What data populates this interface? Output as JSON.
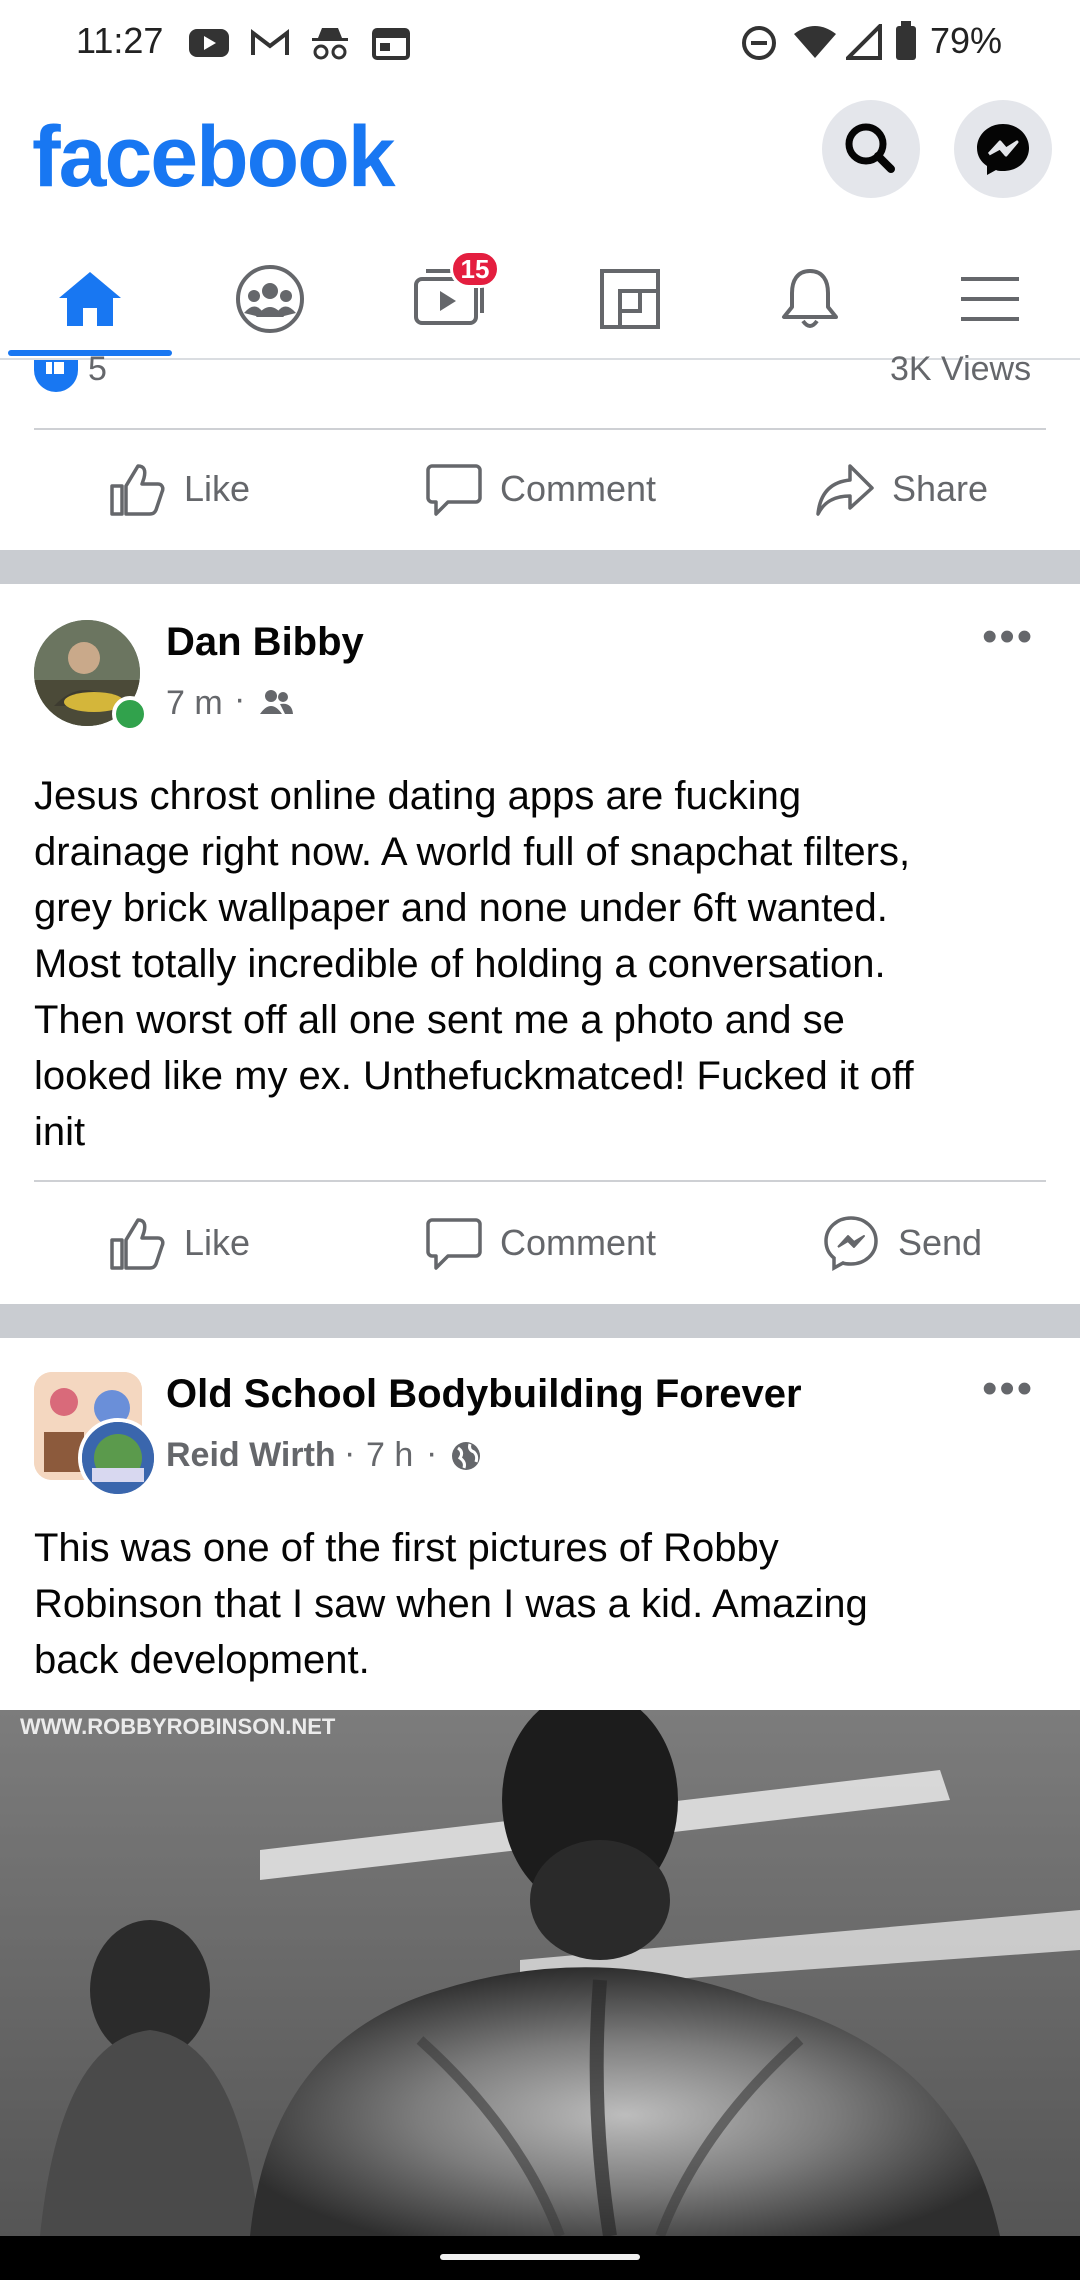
{
  "status_bar": {
    "time": "11:27",
    "battery": "79%",
    "left_icons": [
      "youtube-icon",
      "gmail-icon",
      "incognito-icon",
      "calendar-icon"
    ],
    "right_icons": [
      "do-not-disturb-icon",
      "wifi-icon",
      "signal-icon",
      "battery-icon"
    ]
  },
  "header": {
    "logo": "facebook",
    "brand_color": "#1877f2"
  },
  "tabs": [
    {
      "name": "home",
      "icon": "home-icon",
      "active": true
    },
    {
      "name": "groups",
      "icon": "groups-icon"
    },
    {
      "name": "watch",
      "icon": "watch-icon",
      "badge": "15"
    },
    {
      "name": "marketplace",
      "icon": "marketplace-icon"
    },
    {
      "name": "notifications",
      "icon": "bell-icon"
    },
    {
      "name": "menu",
      "icon": "hamburger-icon"
    }
  ],
  "prev_post": {
    "reaction_count": "5",
    "views": "3K Views",
    "actions": {
      "like": "Like",
      "comment": "Comment",
      "share": "Share"
    }
  },
  "post1": {
    "author": "Dan Bibby",
    "time": "7 m",
    "audience_icon": "friends-icon",
    "text_lines": [
      "Jesus chrost online dating apps are fucking",
      "drainage right now. A world full of snapchat filters,",
      "grey brick wallpaper and none under 6ft wanted.",
      "Most totally incredible of holding a conversation.",
      "Then worst off all one sent me a photo and se",
      "looked like my ex. Unthefuckmatced! Fucked it off",
      "init"
    ],
    "actions": {
      "like": "Like",
      "comment": "Comment",
      "send": "Send"
    }
  },
  "post2": {
    "group": "Old School Bodybuilding Forever",
    "author": "Reid Wirth",
    "time": "7 h",
    "audience_icon": "globe-icon",
    "text_lines": [
      "This was one of the first pictures of Robby",
      "Robinson that I saw when I was a kid. Amazing",
      "back development."
    ],
    "image_watermark": "WWW.ROBBYROBINSON.NET"
  }
}
